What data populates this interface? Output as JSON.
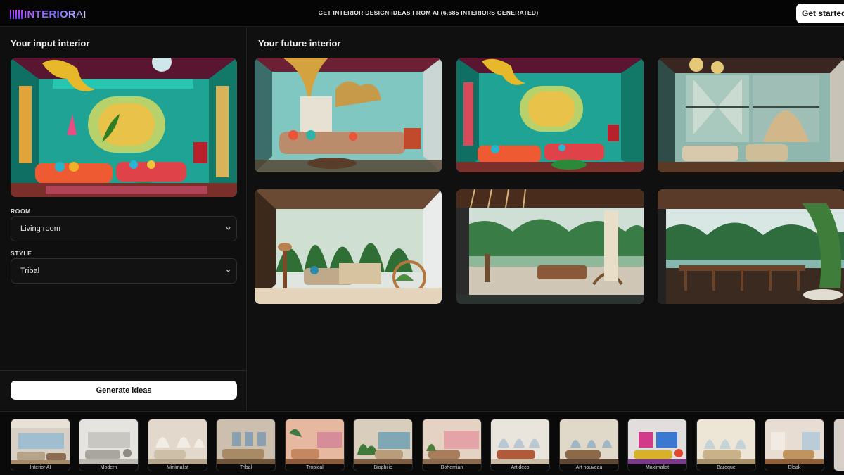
{
  "header": {
    "logo_text": "INTERIOR",
    "logo_suffix": "AI",
    "headline": "GET INTERIOR DESIGN IDEAS FROM AI (6,685 INTERIORS GENERATED)",
    "cta_label": "Get started"
  },
  "input_panel": {
    "title": "Your input interior",
    "room": {
      "label": "ROOM",
      "value": "Living room"
    },
    "style": {
      "label": "STYLE",
      "value": "Tribal"
    },
    "generate_label": "Generate ideas"
  },
  "output_panel": {
    "title": "Your future interior"
  },
  "style_strip": {
    "items": [
      {
        "label": "Interior AI"
      },
      {
        "label": "Modern"
      },
      {
        "label": "Minimalist"
      },
      {
        "label": "Tribal"
      },
      {
        "label": "Tropical"
      },
      {
        "label": "Biophilic"
      },
      {
        "label": "Bohemian"
      },
      {
        "label": "Art deco"
      },
      {
        "label": "Art nouveau"
      },
      {
        "label": "Maximalist"
      },
      {
        "label": "Baroque"
      },
      {
        "label": "Bleak"
      }
    ]
  },
  "colors": {
    "accent_gradient_start": "#b45cff",
    "accent_gradient_end": "#6a3dff",
    "button_bg": "#ffffff",
    "page_bg": "#0b0b0b"
  },
  "icons": {
    "select_chevron": "chevron-down-icon"
  }
}
